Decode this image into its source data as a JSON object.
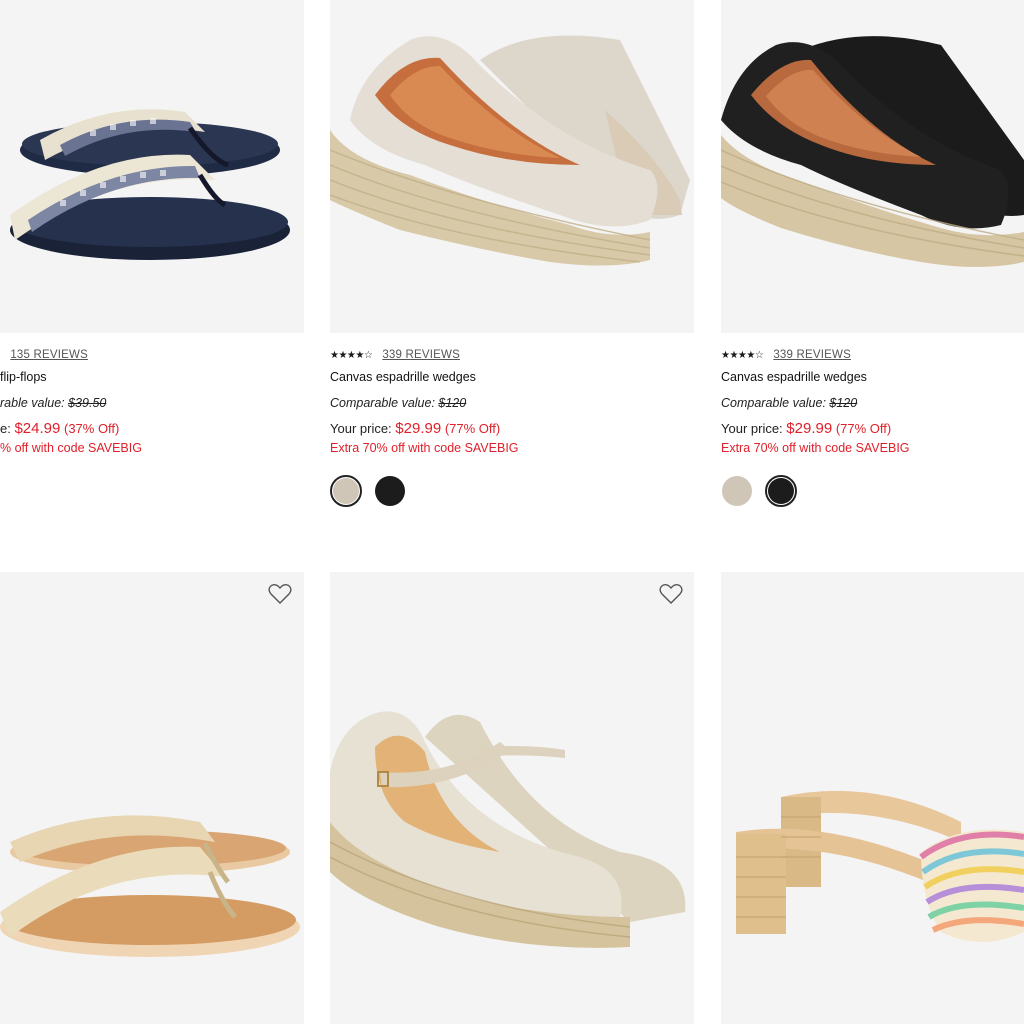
{
  "products": [
    {
      "name": "flip-flops",
      "stars": "★★★★☆",
      "reviews": "135 REVIEWS",
      "comparable_label": "rable value:",
      "comparable_price": "$39.50",
      "price_label": "e:",
      "price": "$24.99",
      "discount": "(37% Off)",
      "promo": "% off with code SAVEBIG",
      "swatches": []
    },
    {
      "name": "Canvas espadrille wedges",
      "stars": "★★★★☆",
      "reviews": "339 REVIEWS",
      "comparable_label": "Comparable value:",
      "comparable_price": "$120",
      "price_label": "Your price:",
      "price": "$29.99",
      "discount": "(77% Off)",
      "promo": "Extra 70% off with code SAVEBIG",
      "swatches": [
        {
          "name": "beige",
          "color": "#cfc6b8",
          "selected": true
        },
        {
          "name": "black",
          "color": "#1c1c1c",
          "selected": false
        }
      ]
    },
    {
      "name": "Canvas espadrille wedges",
      "stars": "★★★★☆",
      "reviews": "339 REVIEWS",
      "comparable_label": "Comparable value:",
      "comparable_price": "$120",
      "price_label": "Your price:",
      "price": "$29.99",
      "discount": "(77% Off)",
      "promo": "Extra 70% off with code SAVEBIG",
      "swatches": [
        {
          "name": "beige",
          "color": "#cfc6b8",
          "selected": false
        },
        {
          "name": "black",
          "color": "#1c1c1c",
          "selected": true
        }
      ]
    }
  ],
  "colors": {
    "sale_red": "#e0202a",
    "image_bg": "#f4f4f4"
  },
  "icons": {
    "wishlist": "heart-icon"
  }
}
